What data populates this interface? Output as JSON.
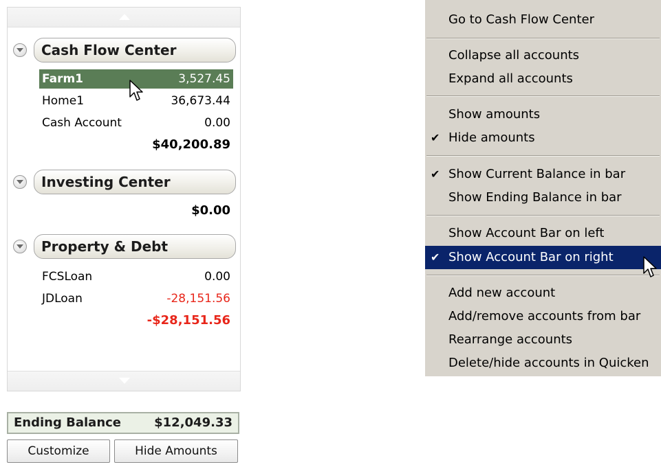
{
  "account_bar": {
    "groups": [
      {
        "title": "Cash Flow Center",
        "accounts": [
          {
            "name": "Farm1",
            "amount": "3,527.45"
          },
          {
            "name": "Home1",
            "amount": "36,673.44"
          },
          {
            "name": "Cash Account",
            "amount": "0.00"
          }
        ],
        "total": "$40,200.89"
      },
      {
        "title": "Investing Center",
        "accounts": [],
        "total": "$0.00"
      },
      {
        "title": "Property & Debt",
        "accounts": [
          {
            "name": "FCSLoan",
            "amount": "0.00"
          },
          {
            "name": "JDLoan",
            "amount": "-28,151.56"
          }
        ],
        "total": "-$28,151.56"
      }
    ],
    "ending_balance": {
      "label": "Ending Balance",
      "value": "$12,049.33"
    },
    "buttons": {
      "customize": "Customize",
      "hide_amounts": "Hide Amounts"
    },
    "selected_row_color": "#5a7d56",
    "negative_color": "#e8261a"
  },
  "context_menu": {
    "highlight_color": "#0a246a",
    "items": [
      {
        "label": "Go to Cash Flow Center",
        "checked": false
      },
      {
        "label": "Collapse all accounts",
        "checked": false
      },
      {
        "label": "Expand all accounts",
        "checked": false
      },
      {
        "label": "Show amounts",
        "checked": false
      },
      {
        "label": "Hide amounts",
        "checked": true
      },
      {
        "label": "Show Current Balance in bar",
        "checked": true
      },
      {
        "label": "Show Ending Balance in bar",
        "checked": false
      },
      {
        "label": "Show Account Bar on left",
        "checked": false
      },
      {
        "label": "Show Account Bar on right",
        "checked": true,
        "highlighted": true
      },
      {
        "label": "Add new account",
        "checked": false
      },
      {
        "label": "Add/remove accounts from bar",
        "checked": false
      },
      {
        "label": "Rearrange accounts",
        "checked": false
      },
      {
        "label": "Delete/hide accounts in Quicken",
        "checked": false
      }
    ],
    "check_glyph": "✔"
  }
}
